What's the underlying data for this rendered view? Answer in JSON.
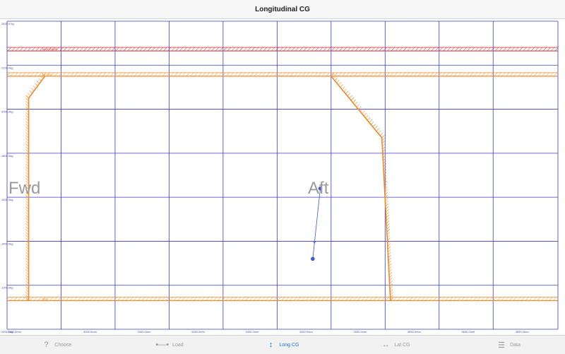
{
  "title": "Longitudinal CG",
  "chart_data": {
    "type": "line",
    "x_min": 3180,
    "x_max": 3690,
    "y_min": 1000,
    "y_max": 2400,
    "y_ticks": [
      {
        "v": 2400,
        "label": "2400.0 kg"
      },
      {
        "v": 2200,
        "label": "2200.0kg"
      },
      {
        "v": 2000,
        "label": "2000.0kg"
      },
      {
        "v": 1800,
        "label": "1800.0kg"
      },
      {
        "v": 1600,
        "label": "1600.0kg"
      },
      {
        "v": 1400,
        "label": "1400.0kg"
      },
      {
        "v": 1200,
        "label": "1200.0kg"
      },
      {
        "v": 1000,
        "label": "1000.0kg"
      }
    ],
    "x_ticks": [
      {
        "v": 3180,
        "label": "3180.0mm"
      },
      {
        "v": 3250,
        "label": "3250.0mm"
      },
      {
        "v": 3300,
        "label": "3300.0mm"
      },
      {
        "v": 3350,
        "label": "3350.0mm"
      },
      {
        "v": 3400,
        "label": "3400.0mm"
      },
      {
        "v": 3450,
        "label": "3450.0mm"
      },
      {
        "v": 3500,
        "label": "3500.0mm"
      },
      {
        "v": 3550,
        "label": "3550.0mm"
      },
      {
        "v": 3600,
        "label": "3600.0mm"
      },
      {
        "v": 3650,
        "label": "3650.0mm"
      }
    ],
    "x_grid": [
      3180,
      3230,
      3280,
      3330,
      3380,
      3430,
      3480,
      3530,
      3580,
      3630,
      3690
    ],
    "max_ramp": {
      "label": "MAX RAMP",
      "y": 2265,
      "color": "#d63a3a"
    },
    "max_takeoff": {
      "label": "MTOW",
      "y": 2150,
      "color": "#f08a2a"
    },
    "min_weight": {
      "label": "MIN",
      "y": 1130,
      "color": "#f08a2a"
    },
    "envelope": {
      "color": "#f08a2a",
      "points": [
        [
          3200,
          1130
        ],
        [
          3200,
          2050
        ],
        [
          3215,
          2150
        ],
        [
          3480,
          2150
        ],
        [
          3527,
          1870
        ],
        [
          3535,
          1130
        ]
      ]
    },
    "load_path": {
      "color": "#3a5bd0",
      "points": [
        [
          3470,
          1640
        ],
        [
          3463,
          1320
        ]
      ]
    },
    "region_labels": {
      "fwd": "Fwd",
      "aft": "Aft"
    }
  },
  "tabs": [
    {
      "label": "Choose",
      "icon": "?",
      "icon_name": "question-icon",
      "active": false
    },
    {
      "label": "Load",
      "icon": "•—•",
      "icon_name": "load-icon",
      "active": false
    },
    {
      "label": "Long CG",
      "icon": "↕",
      "icon_name": "vertical-arrows-icon",
      "active": true
    },
    {
      "label": "Lat CG",
      "icon": "↔",
      "icon_name": "horizontal-arrows-icon",
      "active": false
    },
    {
      "label": "Data",
      "icon": "☰",
      "icon_name": "data-icon",
      "active": false
    }
  ]
}
